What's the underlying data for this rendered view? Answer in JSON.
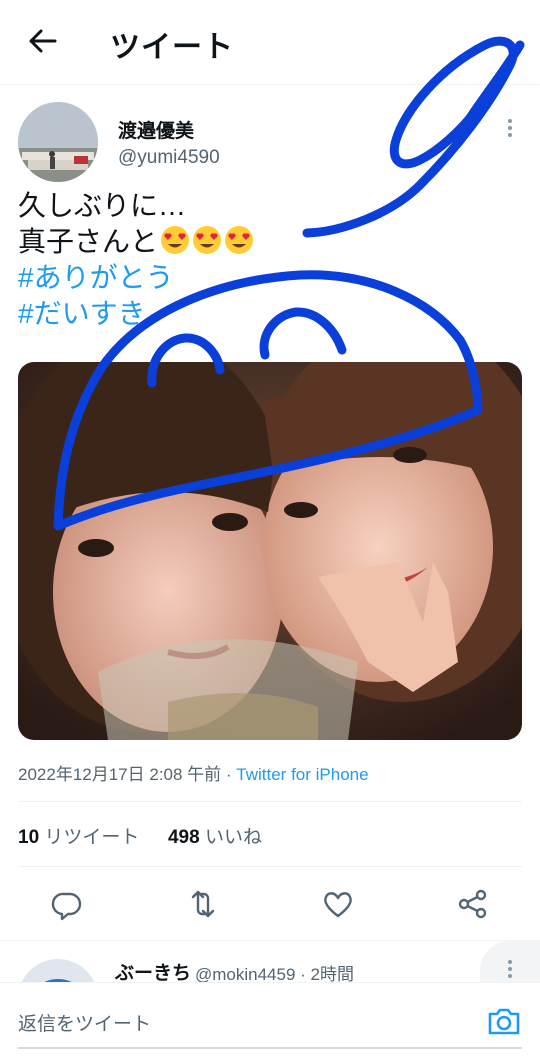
{
  "header": {
    "title": "ツイート",
    "back_icon": "back-arrow-icon"
  },
  "tweet": {
    "author_name": "渡邉優美",
    "author_handle": "@yumi4590",
    "text_line1": "久しぶりに…",
    "text_line2": "真子さんと",
    "emoji": "heart-eyes-emoji",
    "hashtag1": "#ありがとう",
    "hashtag2": "#だいすき",
    "timestamp": "2022年12月17日 2:08 午前",
    "separator": " · ",
    "source": "Twitter for iPhone"
  },
  "stats": {
    "retweets_count": "10",
    "retweets_label": " リツイート",
    "likes_count": "498",
    "likes_label": " いいね"
  },
  "actions": [
    "reply-icon",
    "retweet-icon",
    "like-icon",
    "share-icon"
  ],
  "reply": {
    "name": "ぶーきち",
    "handle": "@mokin4459 · 2時間"
  },
  "compose": {
    "placeholder": "返信をツイート",
    "camera_icon": "camera-icon"
  },
  "colors": {
    "link": "#1d9bf0",
    "doodle": "#0b3fd9",
    "secondary_text": "#536471"
  }
}
